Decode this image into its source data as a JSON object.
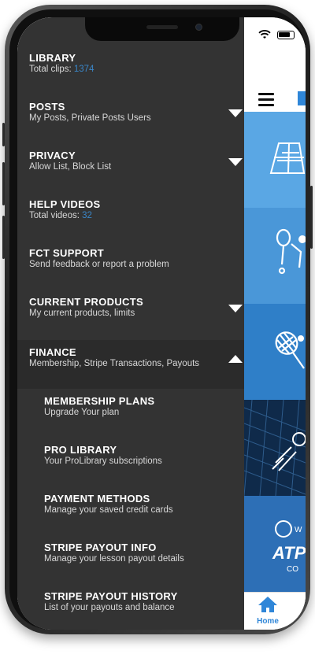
{
  "drawer": {
    "items": [
      {
        "title": "LIBRARY",
        "subtitle": "Total clips:",
        "count": "1374"
      },
      {
        "title": "POSTS",
        "subtitle": "My Posts, Private Posts Users",
        "arrow": "down"
      },
      {
        "title": "PRIVACY",
        "subtitle": "Allow List, Block List",
        "arrow": "down"
      },
      {
        "title": "HELP VIDEOS",
        "subtitle": "Total videos:",
        "count": "32"
      },
      {
        "title": "FCT SUPPORT",
        "subtitle": "Send feedback or report a problem"
      },
      {
        "title": "CURRENT PRODUCTS",
        "subtitle": "My current products, limits",
        "arrow": "down"
      },
      {
        "title": "FINANCE",
        "subtitle": "Membership, Stripe Transactions, Payouts",
        "arrow": "up"
      }
    ],
    "sub_items": [
      {
        "title": "MEMBERSHIP PLANS",
        "subtitle": "Upgrade Your plan"
      },
      {
        "title": "PRO LIBRARY",
        "subtitle": "Your ProLibrary subscriptions"
      },
      {
        "title": "PAYMENT METHODS",
        "subtitle": "Manage your saved credit cards"
      },
      {
        "title": "STRIPE PAYOUT INFO",
        "subtitle": "Manage your lesson payout details"
      },
      {
        "title": "STRIPE PAYOUT HISTORY",
        "subtitle": "List of your payouts and balance"
      }
    ]
  },
  "tabbar": {
    "home_label": "Home"
  },
  "colors": {
    "drawer_bg": "#333333",
    "accent": "#2f86d8",
    "count": "#3a86c8"
  },
  "icons": [
    "hamburger-icon",
    "wifi-icon",
    "battery-icon",
    "home-icon",
    "chevron-down-icon",
    "chevron-up-icon"
  ]
}
